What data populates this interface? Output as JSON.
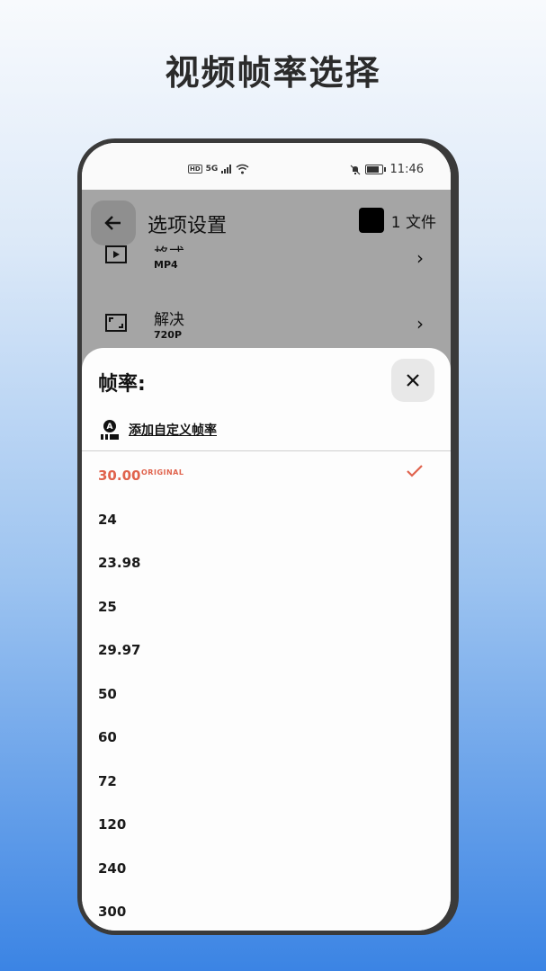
{
  "hero": {
    "title": "视频帧率选择"
  },
  "status_bar": {
    "hd": "HD",
    "network": "5G",
    "time": "11:46"
  },
  "header": {
    "title": "选项设置",
    "file_count": "1 文件"
  },
  "settings": [
    {
      "label": "格式",
      "value": "MP4"
    },
    {
      "label": "解决",
      "value": "720P"
    }
  ],
  "sheet": {
    "title": "帧率:",
    "add_custom": "添加自定义帧率",
    "selected_tag": "ORIGINAL",
    "options": [
      "30.00",
      "24",
      "23.98",
      "25",
      "29.97",
      "50",
      "60",
      "72",
      "120",
      "240",
      "300"
    ]
  },
  "colors": {
    "accent": "#e0634d",
    "overlay": "#a5a5a5",
    "frame": "#3a3a3a"
  },
  "icons": [
    "back-arrow-icon",
    "play-icon",
    "resolution-icon",
    "chevron-right-icon",
    "close-icon",
    "custom-fps-icon",
    "checkmark-icon",
    "wifi-icon",
    "signal-icon",
    "mute-bell-icon",
    "battery-icon"
  ]
}
